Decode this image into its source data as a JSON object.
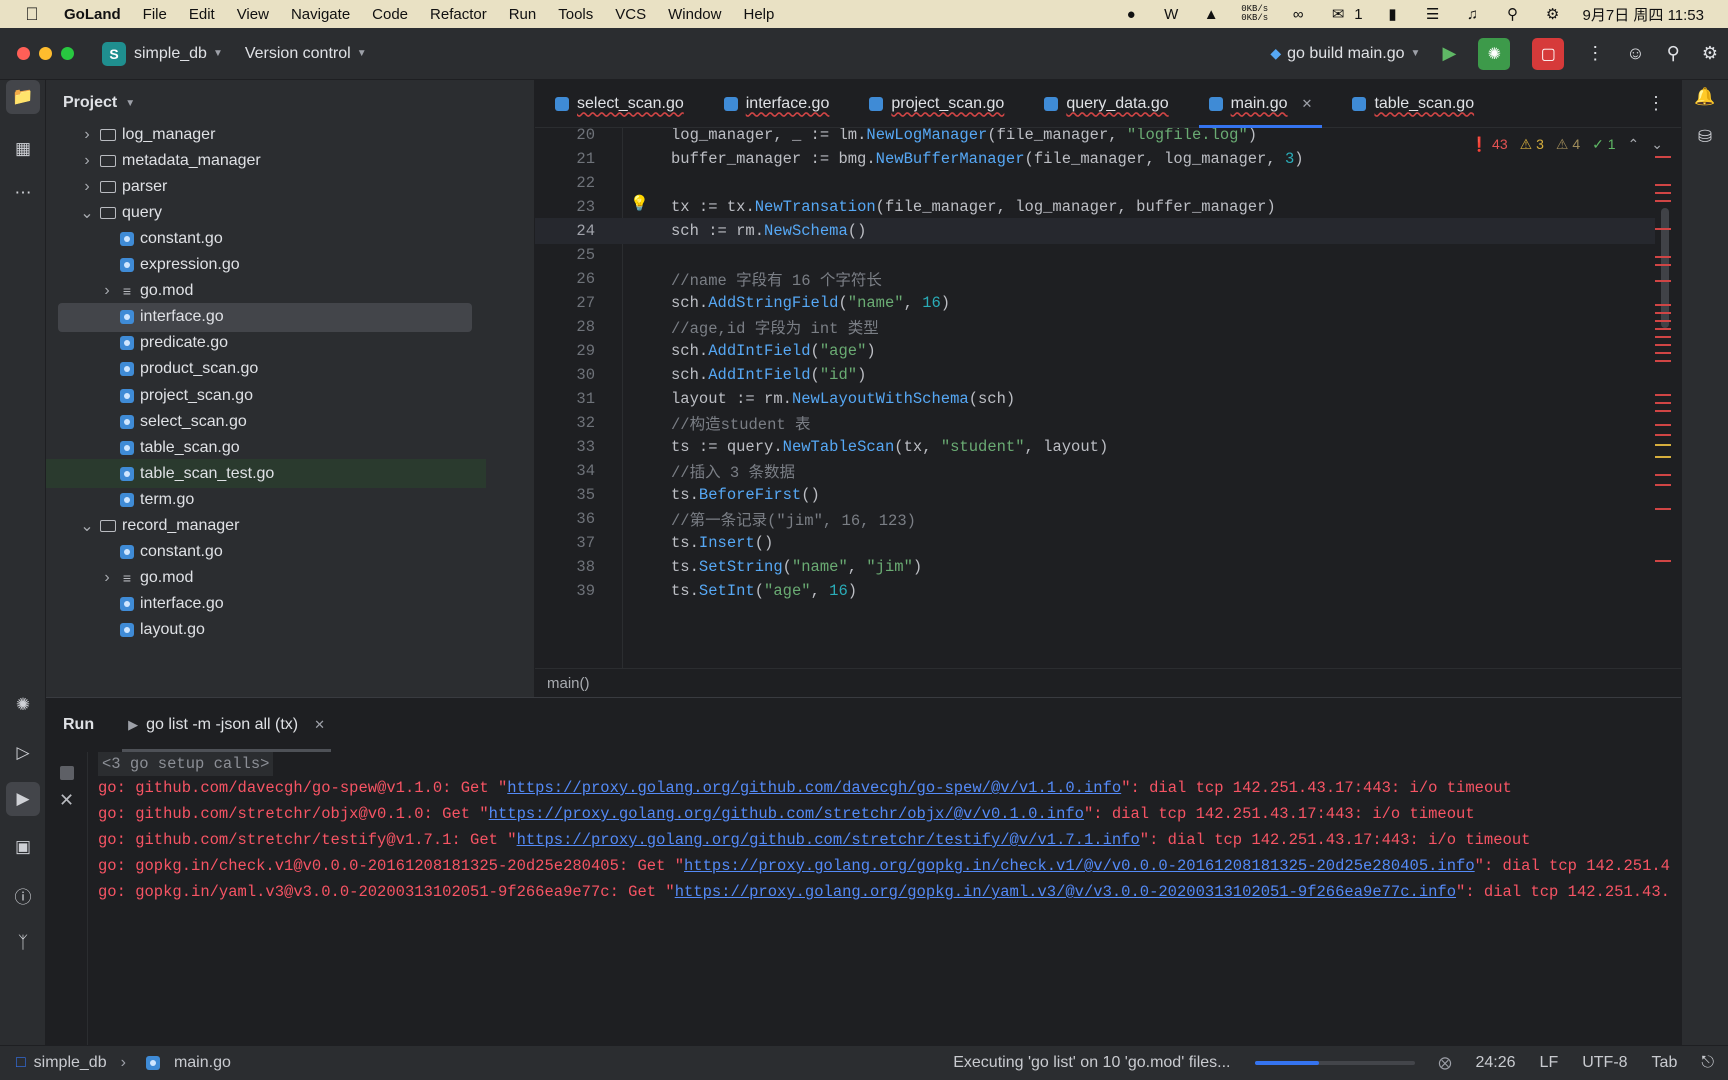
{
  "menubar": {
    "app_name": "GoLand",
    "items": [
      "File",
      "Edit",
      "View",
      "Navigate",
      "Code",
      "Refactor",
      "Run",
      "Tools",
      "VCS",
      "Window",
      "Help"
    ],
    "net_up": "0KB/s",
    "net_down": "0KB/s",
    "wechat_count": "1",
    "datetime": "9月7日 周四  11:53"
  },
  "titlebar": {
    "project_letter": "S",
    "project_name": "simple_db",
    "vcs": "Version control",
    "run_config": "go build main.go"
  },
  "project": {
    "header": "Project",
    "tree": [
      {
        "label": "log_manager",
        "type": "folder",
        "indent": 1,
        "expanded": false
      },
      {
        "label": "metadata_manager",
        "type": "folder",
        "indent": 1,
        "expanded": false
      },
      {
        "label": "parser",
        "type": "folder",
        "indent": 1,
        "expanded": false
      },
      {
        "label": "query",
        "type": "folder",
        "indent": 1,
        "expanded": true
      },
      {
        "label": "constant.go",
        "type": "go",
        "indent": 2
      },
      {
        "label": "expression.go",
        "type": "go",
        "indent": 2
      },
      {
        "label": "go.mod",
        "type": "mod",
        "indent": 2,
        "expanded": false
      },
      {
        "label": "interface.go",
        "type": "go",
        "indent": 2,
        "selected": true
      },
      {
        "label": "predicate.go",
        "type": "go",
        "indent": 2
      },
      {
        "label": "product_scan.go",
        "type": "go",
        "indent": 2
      },
      {
        "label": "project_scan.go",
        "type": "go",
        "indent": 2
      },
      {
        "label": "select_scan.go",
        "type": "go",
        "indent": 2
      },
      {
        "label": "table_scan.go",
        "type": "go",
        "indent": 2
      },
      {
        "label": "table_scan_test.go",
        "type": "go",
        "indent": 2,
        "highlight": true
      },
      {
        "label": "term.go",
        "type": "go",
        "indent": 2
      },
      {
        "label": "record_manager",
        "type": "folder",
        "indent": 1,
        "expanded": true
      },
      {
        "label": "constant.go",
        "type": "go",
        "indent": 2
      },
      {
        "label": "go.mod",
        "type": "mod",
        "indent": 2,
        "expanded": false
      },
      {
        "label": "interface.go",
        "type": "go",
        "indent": 2
      },
      {
        "label": "layout.go",
        "type": "go",
        "indent": 2
      }
    ]
  },
  "tabs": [
    {
      "label": "select_scan.go",
      "active": false
    },
    {
      "label": "interface.go",
      "active": false
    },
    {
      "label": "project_scan.go",
      "active": false
    },
    {
      "label": "query_data.go",
      "active": false
    },
    {
      "label": "main.go",
      "active": true
    },
    {
      "label": "table_scan.go",
      "active": false
    }
  ],
  "inspections": {
    "errors": "43",
    "warnings": "3",
    "weak_warnings": "4",
    "ok": "1"
  },
  "editor": {
    "current_line": "24",
    "lines": [
      {
        "n": "20",
        "code": "log_manager, _ := lm.NewLogManager(file_manager, \"logfile.log\")"
      },
      {
        "n": "21",
        "code": "buffer_manager := bmg.NewBufferManager(file_manager, log_manager, 3)"
      },
      {
        "n": "22",
        "code": ""
      },
      {
        "n": "23",
        "code": "tx := tx.NewTransation(file_manager, log_manager, buffer_manager)"
      },
      {
        "n": "24",
        "code": "sch := rm.NewSchema()"
      },
      {
        "n": "25",
        "code": ""
      },
      {
        "n": "26",
        "code": "//name 字段有 16 个字符长"
      },
      {
        "n": "27",
        "code": "sch.AddStringField(\"name\", 16)"
      },
      {
        "n": "28",
        "code": "//age,id 字段为 int 类型"
      },
      {
        "n": "29",
        "code": "sch.AddIntField(\"age\")"
      },
      {
        "n": "30",
        "code": "sch.AddIntField(\"id\")"
      },
      {
        "n": "31",
        "code": "layout := rm.NewLayoutWithSchema(sch)"
      },
      {
        "n": "32",
        "code": "//构造student 表"
      },
      {
        "n": "33",
        "code": "ts := query.NewTableScan(tx, \"student\", layout)"
      },
      {
        "n": "34",
        "code": "//插入 3 条数据"
      },
      {
        "n": "35",
        "code": "ts.BeforeFirst()"
      },
      {
        "n": "36",
        "code": "//第一条记录(\"jim\", 16, 123)"
      },
      {
        "n": "37",
        "code": "ts.Insert()"
      },
      {
        "n": "38",
        "code": "ts.SetString(\"name\", \"jim\")"
      },
      {
        "n": "39",
        "code": "ts.SetInt(\"age\", 16)"
      }
    ],
    "breadcrumb": "main()"
  },
  "run": {
    "title": "Run",
    "tab_label": "go list -m -json all (tx)",
    "fold_text": "<3 go setup calls>",
    "lines": [
      {
        "pre": "go: github.com/davecgh/go-spew@v1.1.0: Get \"",
        "link": "https://proxy.golang.org/github.com/davecgh/go-spew/@v/v1.1.0.info",
        "post": "\": dial tcp 142.251.43.17:443: i/o timeout"
      },
      {
        "pre": "go: github.com/stretchr/objx@v0.1.0: Get \"",
        "link": "https://proxy.golang.org/github.com/stretchr/objx/@v/v0.1.0.info",
        "post": "\": dial tcp 142.251.43.17:443: i/o timeout"
      },
      {
        "pre": "go: github.com/stretchr/testify@v1.7.1: Get \"",
        "link": "https://proxy.golang.org/github.com/stretchr/testify/@v/v1.7.1.info",
        "post": "\": dial tcp 142.251.43.17:443: i/o timeout"
      },
      {
        "pre": "go: gopkg.in/check.v1@v0.0.0-20161208181325-20d25e280405: Get \"",
        "link": "https://proxy.golang.org/gopkg.in/check.v1/@v/v0.0.0-20161208181325-20d25e280405.info",
        "post": "\": dial tcp 142.251.4"
      },
      {
        "pre": "go: gopkg.in/yaml.v3@v3.0.0-20200313102051-9f266ea9e77c: Get \"",
        "link": "https://proxy.golang.org/gopkg.in/yaml.v3/@v/v3.0.0-20200313102051-9f266ea9e77c.info",
        "post": "\": dial tcp 142.251.43."
      }
    ]
  },
  "statusbar": {
    "project": "simple_db",
    "file": "main.go",
    "task": "Executing 'go list' on 10 'go.mod' files...",
    "progress": 0.4,
    "position": "24:26",
    "line_sep": "LF",
    "encoding": "UTF-8",
    "indent": "Tab"
  },
  "colors": {
    "accent": "#3574f0",
    "error": "#d04545",
    "keyword": "#cf8e6d",
    "func": "#56a8f5",
    "string": "#6aab73",
    "number": "#2aacb8",
    "comment": "#7a7e85"
  }
}
